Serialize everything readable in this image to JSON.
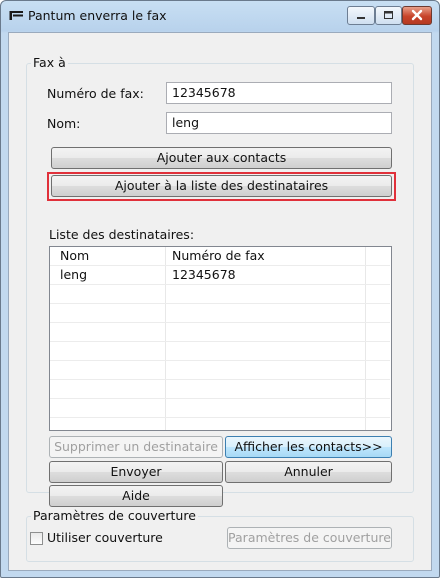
{
  "window": {
    "title": "Pantum enverra le fax",
    "app_icon": "pantum-icon",
    "controls": [
      "minimize-icon",
      "maximize-icon",
      "close-icon"
    ]
  },
  "fax_group": {
    "label": "Fax à",
    "fax_number_label": "Numéro de fax:",
    "fax_number_value": "12345678",
    "name_label": "Nom:",
    "name_value": "leng",
    "add_contacts_button": "Ajouter aux contacts",
    "add_recipients_button": "Ajouter à la liste des destinataires",
    "highlight_color": "#e0303a"
  },
  "recipients": {
    "label": "Liste des destinataires:",
    "columns": [
      "Nom",
      "Numéro de fax"
    ],
    "rows": [
      {
        "name": "leng",
        "fax": "12345678"
      }
    ]
  },
  "actions": {
    "remove_button": "Supprimer un destinataire",
    "show_contacts_button": "Afficher les contacts>>",
    "send_button": "Envoyer",
    "cancel_button": "Annuler",
    "help_button": "Aide"
  },
  "cover": {
    "label": "Paramètres de couverture",
    "use_cover_label": "Utiliser couverture",
    "use_cover_checked": false,
    "cover_settings_button": "Paramètres de couverture"
  }
}
